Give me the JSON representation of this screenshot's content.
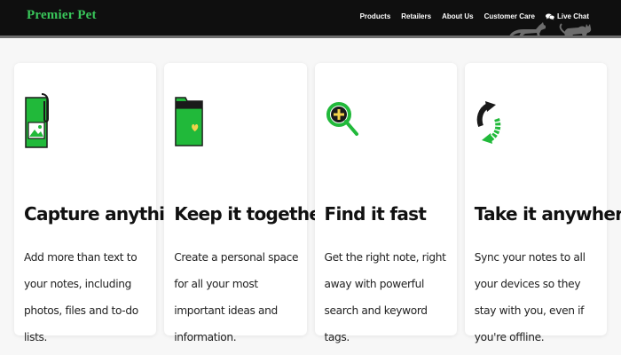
{
  "brand": {
    "name": "Premier Pet",
    "color": "#39c65a"
  },
  "nav": {
    "items": [
      "Products",
      "Retailers",
      "About Us",
      "Customer Care"
    ],
    "live_chat": {
      "label": "Live Chat",
      "icon": "chat-bubbles-icon"
    }
  },
  "accent_color": "#21b93a",
  "cards": [
    {
      "icon": "photo-clip-icon",
      "title": "Capture anything",
      "body": "Add more than text to your notes, including photos, files and to-do lists."
    },
    {
      "icon": "folder-icon",
      "title": "Keep it together",
      "body": "Create a personal space for all your most important ideas and information."
    },
    {
      "icon": "magnifier-icon",
      "title": "Find it fast",
      "body": "Get the right note, right away with powerful search and keyword tags."
    },
    {
      "icon": "sync-arrows-icon",
      "title": "Take it anywhere",
      "body": "Sync your notes to all your devices so they stay with you, even if you're offline."
    }
  ]
}
